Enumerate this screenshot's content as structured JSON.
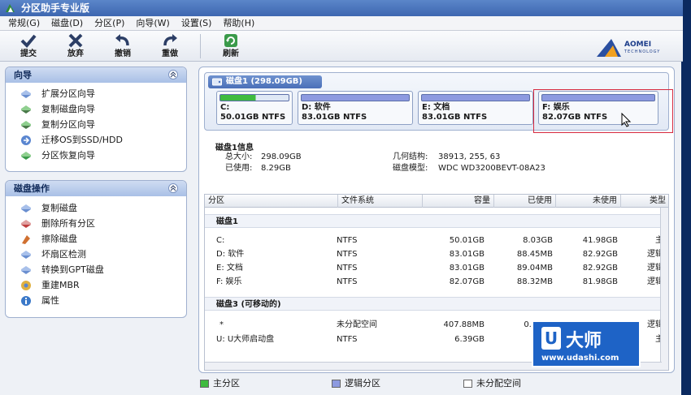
{
  "window": {
    "title": "分区助手专业版"
  },
  "menu": [
    "常规(G)",
    "磁盘(D)",
    "分区(P)",
    "向导(W)",
    "设置(S)",
    "帮助(H)"
  ],
  "toolbar": {
    "commit": "提交",
    "discard": "放弃",
    "undo": "撤销",
    "redo": "重做",
    "refresh": "刷新"
  },
  "brand": {
    "name": "AOMEI",
    "sub": "TECHNOLOGY"
  },
  "wizard_panel": {
    "title": "向导",
    "items": [
      "扩展分区向导",
      "复制磁盘向导",
      "复制分区向导",
      "迁移OS到SSD/HDD",
      "分区恢复向导"
    ]
  },
  "disk_ops_panel": {
    "title": "磁盘操作",
    "items": [
      "复制磁盘",
      "删除所有分区",
      "擦除磁盘",
      "坏扇区检测",
      "转换到GPT磁盘",
      "重建MBR",
      "属性"
    ]
  },
  "disk_map": {
    "header": "磁盘1 (298.09GB)",
    "partitions": [
      {
        "label": "C:",
        "size": "50.01GB NTFS",
        "used_fraction": 0.52
      },
      {
        "label": "D: 软件",
        "size": "83.01GB NTFS",
        "used_fraction": 1.0
      },
      {
        "label": "E: 文档",
        "size": "83.01GB NTFS",
        "used_fraction": 1.0
      },
      {
        "label": "F: 娱乐",
        "size": "82.07GB NTFS",
        "used_fraction": 1.0
      }
    ]
  },
  "disk_info": {
    "title": "磁盘1信息",
    "total_label": "总大小:",
    "total": "298.09GB",
    "used_label": "已使用:",
    "used": "8.29GB",
    "geometry_label": "几何结构:",
    "geometry": "38913, 255, 63",
    "model_label": "磁盘模型:",
    "model": "WDC WD3200BEVT-08A23"
  },
  "table": {
    "columns": [
      "分区",
      "文件系统",
      "容量",
      "已使用",
      "未使用",
      "类型"
    ],
    "sections": [
      {
        "title": "磁盘1",
        "rows": [
          [
            "C:",
            "NTFS",
            "50.01GB",
            "8.03GB",
            "41.98GB",
            "主"
          ],
          [
            "D: 软件",
            "NTFS",
            "83.01GB",
            "88.45MB",
            "82.92GB",
            "逻辑"
          ],
          [
            "E: 文档",
            "NTFS",
            "83.01GB",
            "89.04MB",
            "82.92GB",
            "逻辑"
          ],
          [
            "F: 娱乐",
            "NTFS",
            "82.07GB",
            "88.32MB",
            "81.98GB",
            "逻辑"
          ]
        ]
      },
      {
        "title": "磁盘3 (可移动的)",
        "rows": [
          [
            "*",
            "未分配空间",
            "407.88MB",
            "0.00KB",
            "",
            "逻辑"
          ],
          [
            "U: U大师启动盘",
            "NTFS",
            "6.39GB",
            "",
            "",
            "主"
          ]
        ]
      }
    ]
  },
  "legend": {
    "primary": "主分区",
    "logical": "逻辑分区",
    "unallocated": "未分配空间"
  },
  "watermark": {
    "name": "大师",
    "letter": "U",
    "url": "www.udashi.com"
  },
  "colors": {
    "primary": "#3fbb3f",
    "logical": "#8d9ae0",
    "selection": "#d6283e",
    "watermark": "#1e63c6"
  }
}
